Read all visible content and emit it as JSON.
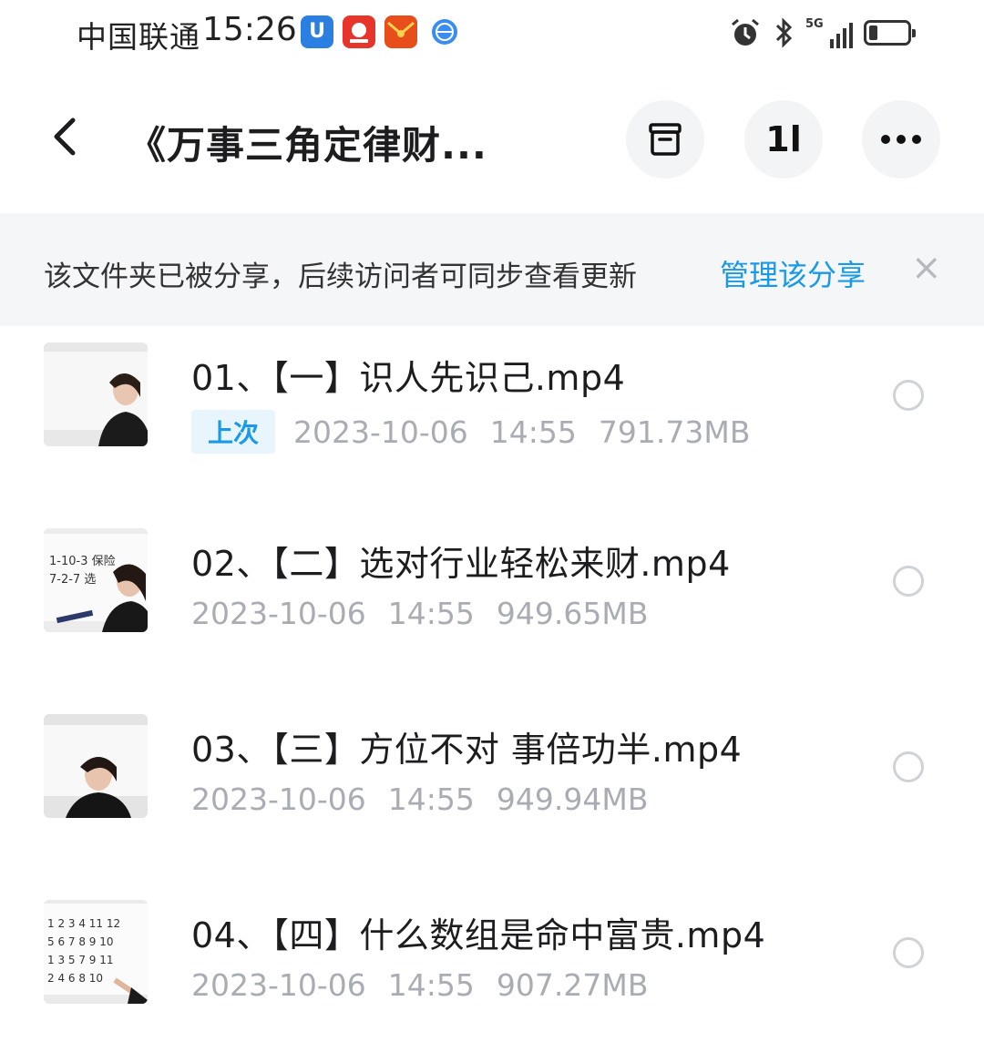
{
  "status_bar": {
    "carrier": "中国联通",
    "time": "15:26",
    "app_icons": [
      "shield-app-icon",
      "red-app-icon",
      "red-envelope-icon",
      "globe-icon"
    ],
    "system_icons": [
      "alarm-icon",
      "bluetooth-icon",
      "5g-signal-icon",
      "battery-icon"
    ],
    "network_label": "5G"
  },
  "header": {
    "title": "《万事三角定律财...",
    "back_icon": "chevron-left-icon",
    "actions": [
      "archive-icon",
      "sort-icon",
      "more-icon"
    ],
    "sort_glyph": "1l"
  },
  "banner": {
    "text": "该文件夹已被分享，后续访问者可同步查看更新",
    "link": "管理该分享",
    "close": "×"
  },
  "files": [
    {
      "name": "01、【一】识人先识己.mp4",
      "badge": "上次",
      "date": "2023-10-06",
      "time": "14:55",
      "size": "791.73MB"
    },
    {
      "name": "02、【二】选对行业轻松来财.mp4",
      "badge": "",
      "date": "2023-10-06",
      "time": "14:55",
      "size": "949.65MB"
    },
    {
      "name": "03、【三】方位不对 事倍功半.mp4",
      "badge": "",
      "date": "2023-10-06",
      "time": "14:55",
      "size": "949.94MB"
    },
    {
      "name": "04、【四】什么数组是命中富贵.mp4",
      "badge": "",
      "date": "2023-10-06",
      "time": "14:55",
      "size": "907.27MB"
    }
  ],
  "colors": {
    "accent": "#1a9ae6",
    "banner_bg": "#f5f6f8",
    "meta_text": "#a9adb3"
  }
}
